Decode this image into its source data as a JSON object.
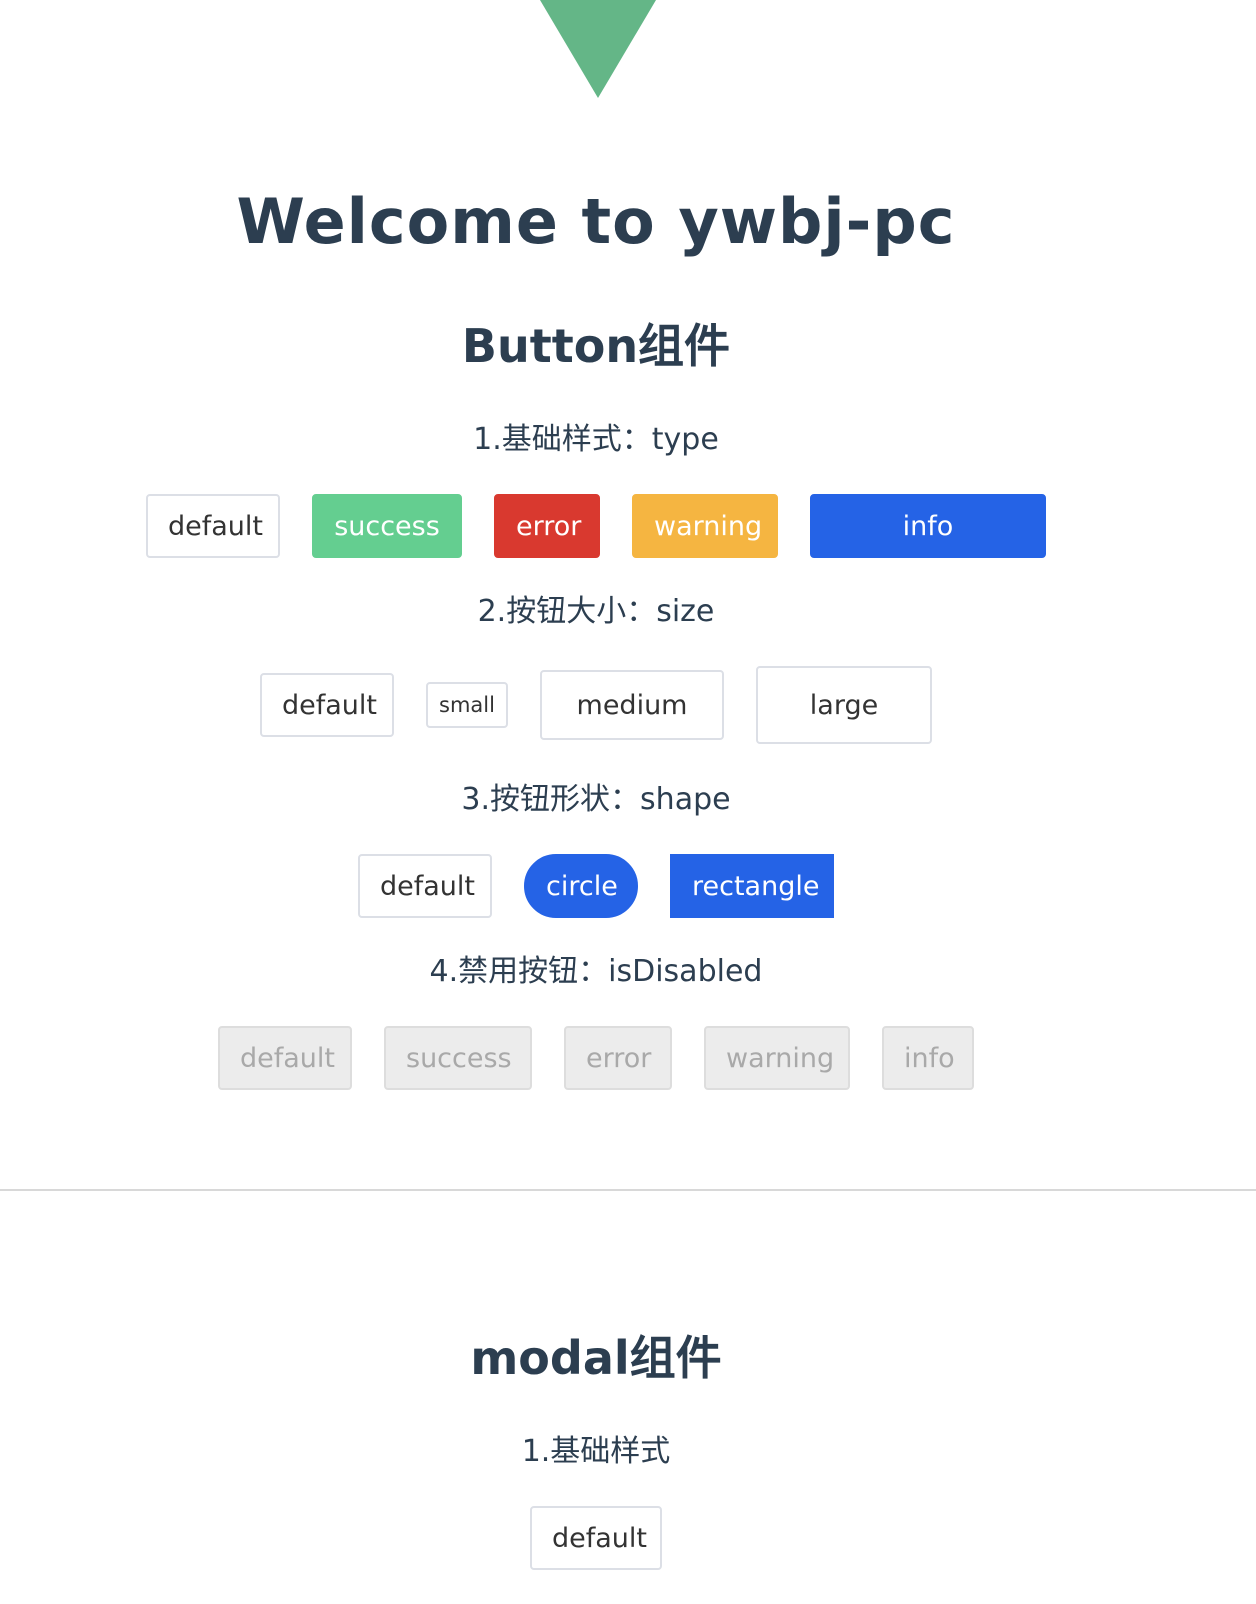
{
  "header": {
    "logo_icon": "green-triangle-logo-icon",
    "logo_color": "#64b687",
    "welcome": "Welcome to ywbj-pc"
  },
  "button_section": {
    "title": "Button组件",
    "type_group": {
      "title": "1.基础样式：type",
      "buttons": [
        "default",
        "success",
        "error",
        "warning",
        "info"
      ]
    },
    "size_group": {
      "title": "2.按钮大小：size",
      "buttons": [
        "default",
        "small",
        "medium",
        "large"
      ]
    },
    "shape_group": {
      "title": "3.按钮形状：shape",
      "buttons": [
        "default",
        "circle",
        "rectangle"
      ]
    },
    "disabled_group": {
      "title": "4.禁用按钮：isDisabled",
      "buttons": [
        "default",
        "success",
        "error",
        "warning",
        "info"
      ]
    }
  },
  "modal_section": {
    "title": "modal组件",
    "basic_group": {
      "title": "1.基础样式",
      "buttons": [
        "default"
      ]
    }
  },
  "colors": {
    "text": "#2c3e50",
    "success": "#64ce90",
    "error": "#d9392f",
    "warning": "#f5b541",
    "info": "#2563e6",
    "disabled_bg": "#ececec"
  }
}
